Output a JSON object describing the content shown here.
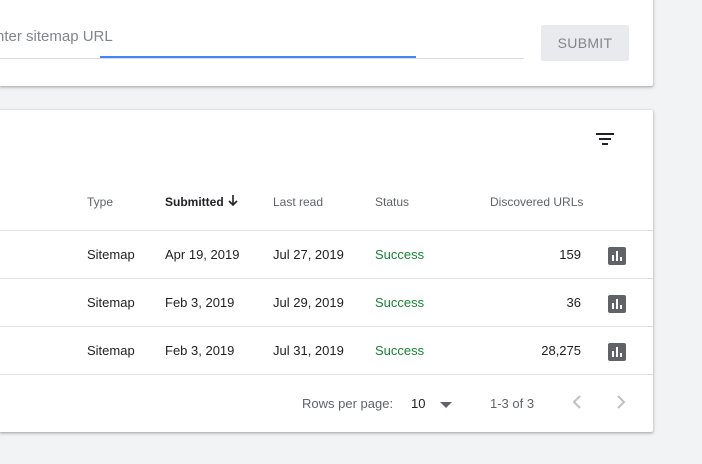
{
  "sitemap_form": {
    "placeholder": "nter sitemap URL",
    "submit_label": "SUBMIT"
  },
  "table": {
    "columns": {
      "type": "Type",
      "submitted": "Submitted",
      "last_read": "Last read",
      "status": "Status",
      "discovered_urls": "Discovered URLs"
    },
    "rows": [
      {
        "type": "Sitemap",
        "submitted": "Apr 19, 2019",
        "last_read": "Jul 27, 2019",
        "status": "Success",
        "discovered_urls": "159"
      },
      {
        "type": "Sitemap",
        "submitted": "Feb 3, 2019",
        "last_read": "Jul 29, 2019",
        "status": "Success",
        "discovered_urls": "36"
      },
      {
        "type": "Sitemap",
        "submitted": "Feb 3, 2019",
        "last_read": "Jul 31, 2019",
        "status": "Success",
        "discovered_urls": "28,275"
      }
    ],
    "icons": {
      "filter": "filter-icon",
      "sort": "arrow-down-icon",
      "row_action": "bar-chart-icon"
    }
  },
  "pagination": {
    "rows_per_page_label": "Rows per page:",
    "rows_per_page_value": "10",
    "range_label": "1-3 of 3"
  },
  "colors": {
    "accent": "#4285f4",
    "success": "#188038"
  }
}
